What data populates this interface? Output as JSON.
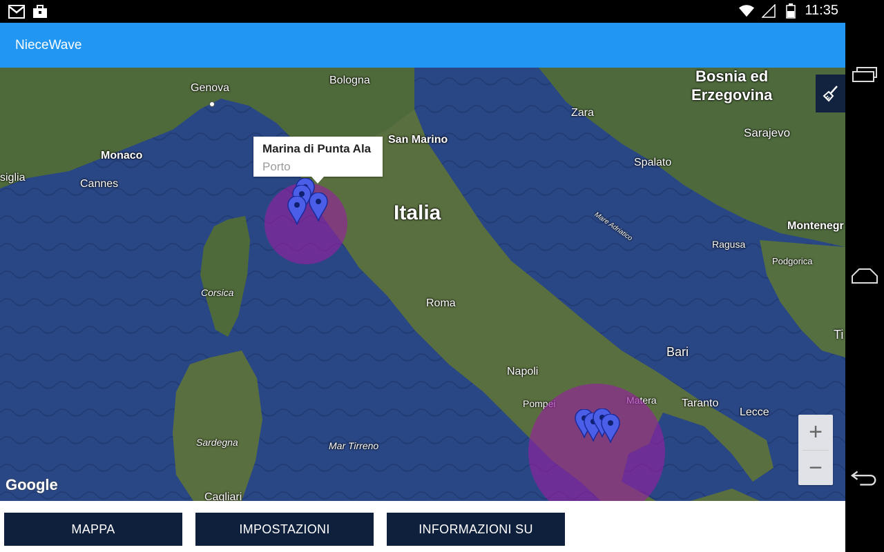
{
  "status": {
    "time": "11:35",
    "icons": [
      "gmail-icon",
      "briefcase-icon",
      "wifi-icon",
      "signal-icon",
      "battery-icon"
    ]
  },
  "app": {
    "title": "NieceWave",
    "accent": "#2196F3"
  },
  "map": {
    "labels": {
      "genova": "Genova",
      "bologna": "Bologna",
      "san_marino": "San Marino",
      "monaco": "Monaco",
      "cannes": "Cannes",
      "siglia": "siglia",
      "italia": "Italia",
      "corsica": "Corsica",
      "roma": "Roma",
      "sardegna": "Sardegna",
      "cagliari": "Cagliari",
      "mar_tirreno": "Mar Tirreno",
      "napoli": "Napoli",
      "pompei": "Pompei",
      "matera": "Matera",
      "taranto": "Taranto",
      "lecce": "Lecce",
      "bari": "Bari",
      "zara": "Zara",
      "spalato": "Spalato",
      "sarajevo": "Sarajevo",
      "bosnia1": "Bosnia ed",
      "bosnia2": "Erzegovina",
      "ragusa": "Ragusa",
      "podgorica": "Podgorica",
      "montenegro": "Montenegr",
      "mare_adriatico": "Mare Adriatico",
      "ti": "Ti"
    },
    "info_window": {
      "title": "Marina di Punta Ala",
      "subtitle": "Porto"
    },
    "zoom": {
      "in": "+",
      "out": "−"
    },
    "attribution": "Google",
    "circle_color": "#961ea0",
    "pin_color": "#4a5ee8"
  },
  "buttons": {
    "map": "MAPPA",
    "settings": "IMPOSTAZIONI",
    "about": "INFORMAZIONI SU"
  }
}
